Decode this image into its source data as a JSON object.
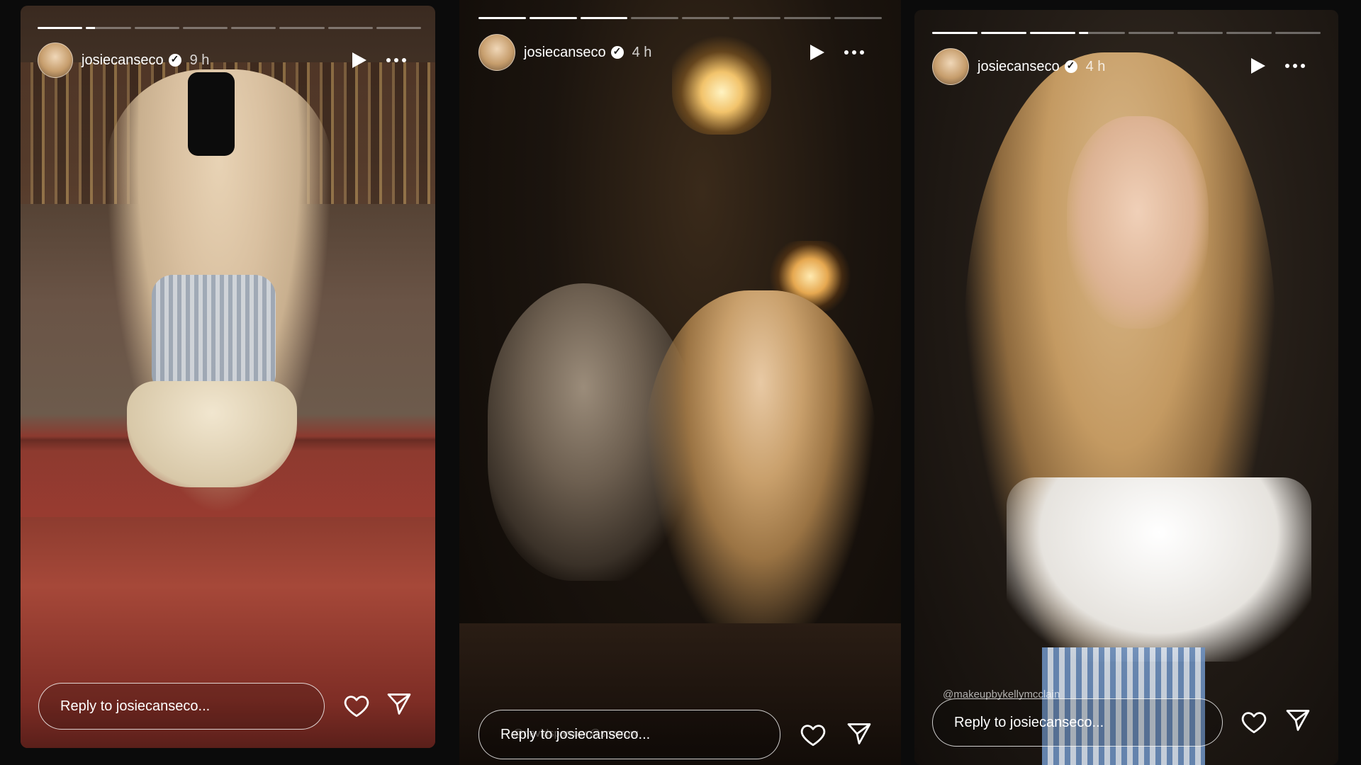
{
  "stories": [
    {
      "username": "josiecanseco",
      "time": "9 h",
      "progress": [
        1,
        0.2,
        0,
        0,
        0,
        0,
        0,
        0
      ],
      "reply_placeholder": "Reply to josiecanseco..."
    },
    {
      "username": "josiecanseco",
      "time": "4 h",
      "progress": [
        1,
        1,
        1,
        0,
        0,
        0,
        0,
        0
      ],
      "reply_placeholder": "Reply to josiecanseco...",
      "mention": "@davidsparrow @sparrow"
    },
    {
      "username": "josiecanseco",
      "time": "4 h",
      "progress": [
        1,
        1,
        1,
        0.2,
        0,
        0,
        0,
        0
      ],
      "reply_placeholder": "Reply to josiecanseco...",
      "mention": "@makeupbykellymcclain"
    }
  ],
  "colors": {
    "background": "#0b0b0b",
    "ui": "#ffffff"
  },
  "icons": [
    "play-icon",
    "more-icon",
    "heart-icon",
    "send-icon",
    "verified-icon"
  ]
}
